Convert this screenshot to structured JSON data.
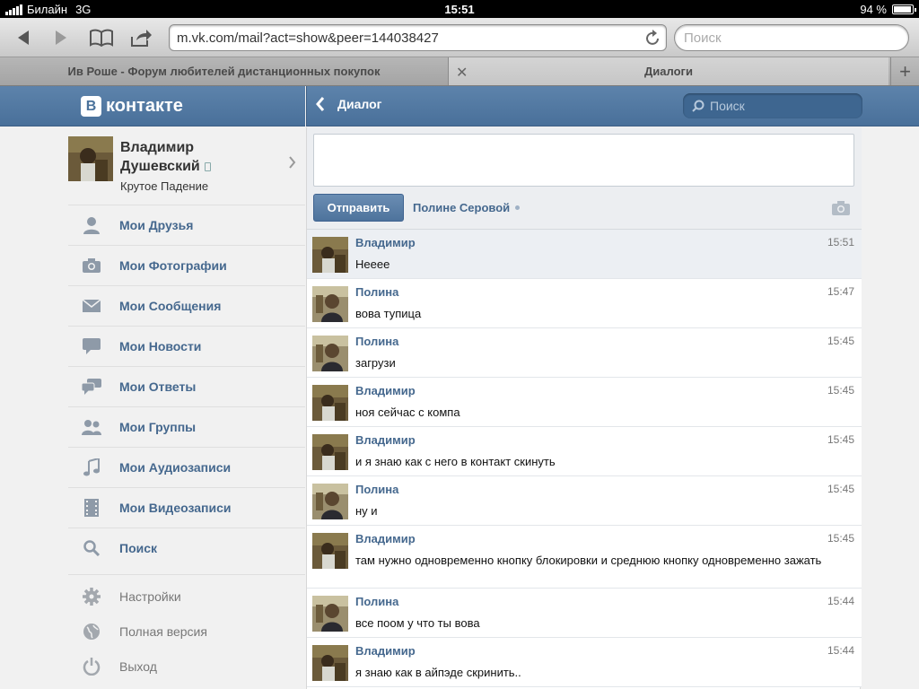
{
  "statusbar": {
    "carrier": "Билайн",
    "network": "3G",
    "time": "15:51",
    "battery": "94 %",
    "battery_level": 0.94
  },
  "browser": {
    "url": "m.vk.com/mail?act=show&peer=144038427",
    "search_placeholder": "Поиск",
    "tabs": [
      {
        "title": "Ив Роше - Форум любителей дистанционных покупок",
        "active": false
      },
      {
        "title": "Диалоги",
        "active": true
      }
    ]
  },
  "vk": {
    "logo_mark": "B",
    "logo_text": "контакте",
    "header": {
      "back_label": "Диалог",
      "search_placeholder": "Поиск"
    },
    "profile": {
      "first_name": "Владимир",
      "last_name": "Душевский",
      "status": "Крутое Падение"
    },
    "menu": [
      {
        "label": "Мои Друзья",
        "icon": "user-icon"
      },
      {
        "label": "Мои Фотографии",
        "icon": "camera-icon"
      },
      {
        "label": "Мои Сообщения",
        "icon": "envelope-icon"
      },
      {
        "label": "Мои Новости",
        "icon": "speech-bubble-icon"
      },
      {
        "label": "Мои Ответы",
        "icon": "chat-bubbles-icon"
      },
      {
        "label": "Мои Группы",
        "icon": "group-icon"
      },
      {
        "label": "Мои Аудиозаписи",
        "icon": "music-note-icon"
      },
      {
        "label": "Мои Видеозаписи",
        "icon": "film-icon"
      },
      {
        "label": "Поиск",
        "icon": "search-icon"
      }
    ],
    "submenu": [
      {
        "label": "Настройки",
        "icon": "gear-icon"
      },
      {
        "label": "Полная версия",
        "icon": "globe-icon"
      },
      {
        "label": "Выход",
        "icon": "power-icon"
      }
    ],
    "compose": {
      "send_label": "Отправить",
      "recipient": "Полине Серовой"
    },
    "messages": [
      {
        "author": "Владимир",
        "time": "15:51",
        "text": "Неееe"
      },
      {
        "author": "Полина",
        "time": "15:47",
        "text": "вова тупица"
      },
      {
        "author": "Полина",
        "time": "15:45",
        "text": "загрузи"
      },
      {
        "author": "Владимир",
        "time": "15:45",
        "text": "ноя сейчас с компа"
      },
      {
        "author": "Владимир",
        "time": "15:45",
        "text": "и я знаю как с него в контакт скинуть"
      },
      {
        "author": "Полина",
        "time": "15:45",
        "text": "ну и"
      },
      {
        "author": "Владимир",
        "time": "15:45",
        "text": "там нужно одновременно кнопку блокировки и среднюю кнопку одновременно зажать"
      },
      {
        "author": "Полина",
        "time": "15:44",
        "text": "все поом у что ты вова"
      },
      {
        "author": "Владимир",
        "time": "15:44",
        "text": "я знаю как в айпэде скринить.."
      }
    ]
  },
  "colors": {
    "vk_header": "#4f759e",
    "vk_link": "#45688e",
    "menu_icon": "#8e9aa8"
  }
}
